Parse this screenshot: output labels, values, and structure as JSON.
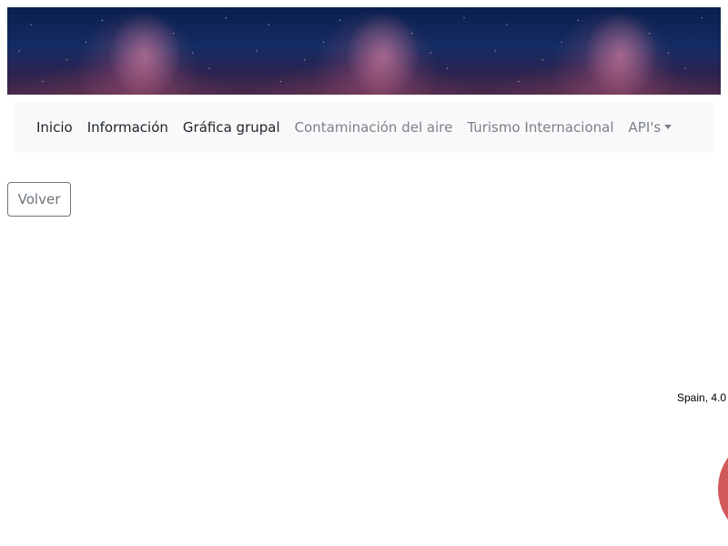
{
  "banner": {
    "image": "milky-way-night-sky"
  },
  "navbar": {
    "items": [
      {
        "label": "Inicio",
        "style": "active"
      },
      {
        "label": "Información",
        "style": "active"
      },
      {
        "label": "Gráfica grupal",
        "style": "active"
      },
      {
        "label": "Contaminación del aire",
        "style": "muted"
      },
      {
        "label": "Turismo Internacional",
        "style": "muted"
      },
      {
        "label": "API's",
        "style": "muted",
        "dropdown": true
      }
    ]
  },
  "actions": {
    "back_label": "Volver"
  },
  "chart": {
    "visible_label": "Spain, 4.0",
    "bubble_color": "#d0595b"
  },
  "colors": {
    "nav_background": "#f8f9fa",
    "nav_active": "#212529",
    "nav_muted": "#7d8186",
    "button_border": "#6c757d"
  }
}
